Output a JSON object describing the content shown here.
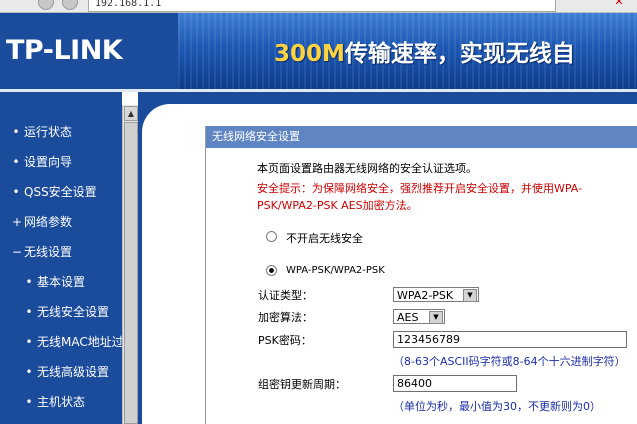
{
  "browser": {
    "address": "192.168.1.1"
  },
  "header": {
    "logo_text": "TP-LINK",
    "banner_highlight": "300M",
    "banner_rest": "传输速率，实现无线自"
  },
  "sidebar": {
    "items": [
      {
        "bullet": "•",
        "label": "运行状态"
      },
      {
        "bullet": "•",
        "label": "设置向导"
      },
      {
        "bullet": "•",
        "label": "QSS安全设置"
      },
      {
        "bullet": "+",
        "label": "网络参数"
      },
      {
        "bullet": "−",
        "label": "无线设置"
      },
      {
        "bullet": "•",
        "label": "基本设置"
      },
      {
        "bullet": "•",
        "label": "无线安全设置"
      },
      {
        "bullet": "•",
        "label": "无线MAC地址过滤"
      },
      {
        "bullet": "•",
        "label": "无线高级设置"
      },
      {
        "bullet": "•",
        "label": "主机状态"
      }
    ]
  },
  "panel": {
    "title": "无线网络安全设置",
    "intro": "本页面设置路由器无线网络的安全认证选项。",
    "warning_line1": "安全提示：为保障网络安全，强烈推荐开启安全设置，并使用WPA-",
    "warning_line2": "PSK/WPA2-PSK AES加密方法。",
    "option_disable_label": "不开启无线安全",
    "option_wpa_label": "WPA-PSK/WPA2-PSK",
    "auth_type_label": "认证类型：",
    "auth_type_value": "WPA2-PSK",
    "encryption_label": "加密算法：",
    "encryption_value": "AES",
    "psk_label": "PSK密码：",
    "psk_value": "123456789",
    "psk_hint": "（8-63个ASCII码字符或8-64个十六进制字符）",
    "renewal_label": "组密钥更新周期：",
    "renewal_value": "86400",
    "renewal_hint": "（单位为秒，最小值为30，不更新则为0）"
  },
  "colors": {
    "brand_blue": "#1b4b9b",
    "title_bar": "#5f86c3",
    "warning_red": "#cc0000",
    "hint_blue": "#1c2fa8"
  }
}
